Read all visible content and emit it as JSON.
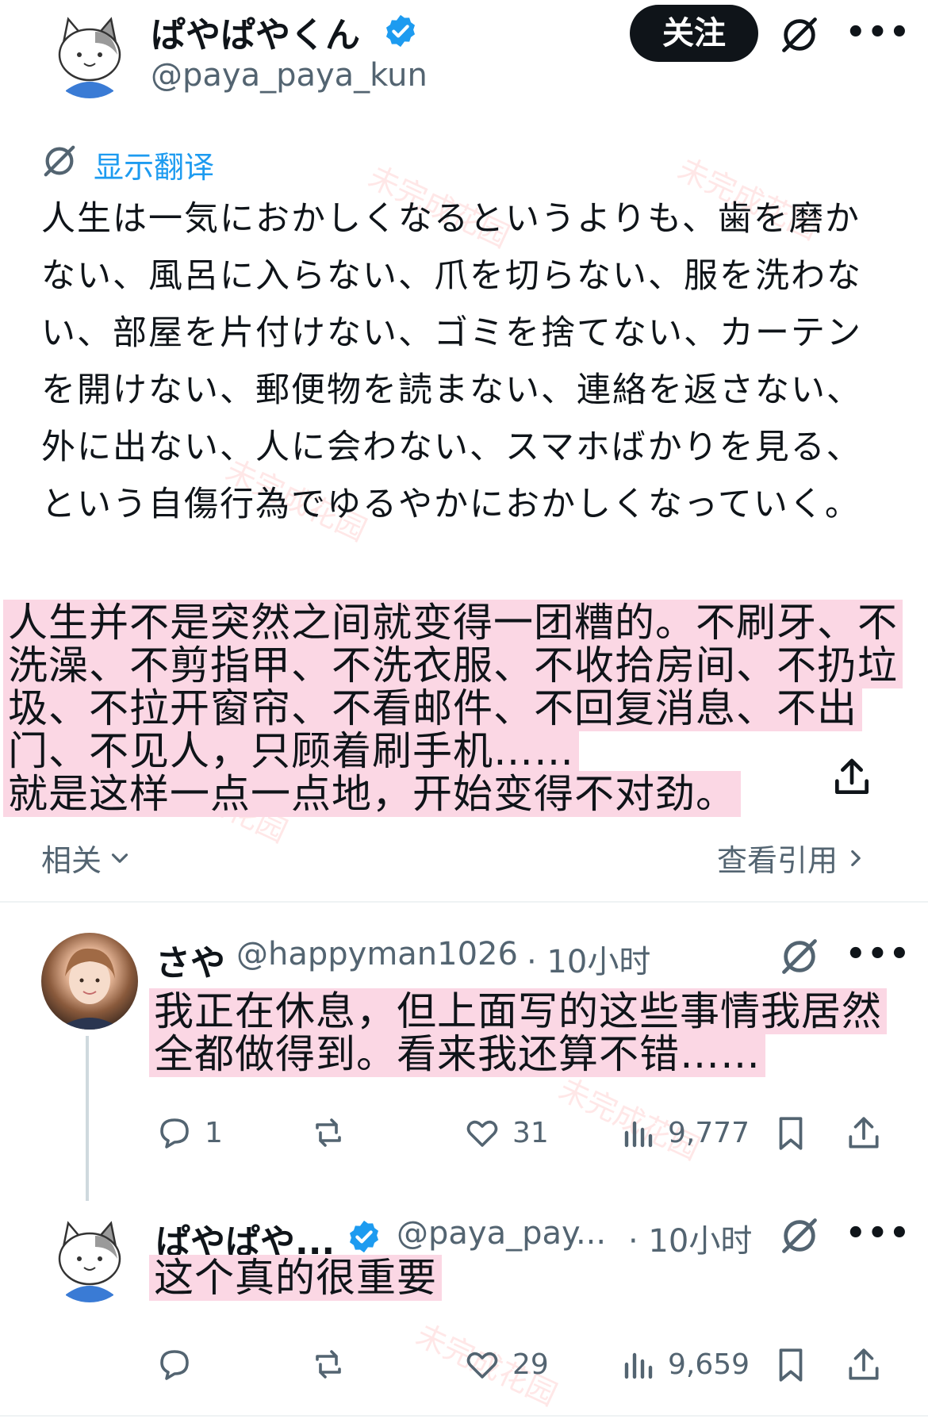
{
  "main_tweet": {
    "author_name": "ぱやぱやくん",
    "author_handle": "@paya_paya_kun",
    "follow_label": "关注",
    "translate_label": "显示翻译",
    "text": "人生は一気におかしくなるというよりも、歯を磨かない、風呂に入らない、爪を切らない、服を洗わない、部屋を片付けない、ゴミを捨てない、カーテンを開けない、郵便物を読まない、連絡を返さない、外に出ない、人に会わない、スマホばかりを見る、という自傷行為でゆるやかにおかしくなっていく。",
    "translation_overlay": "人生并不是突然之间就变得一团糟的。不刷牙、不洗澡、不剪指甲、不洗衣服、不收拾房间、不扔垃圾、不拉开窗帘、不看邮件、不回复消息、不出门、不见人，只顾着刷手机……",
    "translation_overlay_last": "就是这样一点一点地，开始变得不对劲。",
    "related_label": "相关",
    "view_quotes_label": "查看引用"
  },
  "replies": [
    {
      "author_name": "さや",
      "author_handle": "@happyman1026",
      "time": "· 10小时",
      "text": "我正在休息，但上面写的这些事情我居然全都做得到。看来我还算不错……",
      "reply_count": "1",
      "retweet_count": "",
      "like_count": "31",
      "view_count": "9,777"
    },
    {
      "author_name": "ぱやぱや...",
      "author_handle": "@paya_pay...",
      "time": "· 10小时",
      "text": "这个真的很重要",
      "reply_count": "",
      "retweet_count": "",
      "like_count": "29",
      "view_count": "9,659"
    }
  ],
  "watermark_text": "未完成花园",
  "colors": {
    "accent": "#1d9bf0",
    "highlight": "#fbd7e4",
    "text": "#0f1419",
    "secondary": "#536471",
    "button": "#0f1419"
  },
  "icons": [
    "verified-icon",
    "grok-icon",
    "more-icon",
    "chevron-down-icon",
    "chevron-right-icon",
    "share-icon",
    "reply-icon",
    "retweet-icon",
    "like-icon",
    "views-icon",
    "bookmark-icon"
  ]
}
